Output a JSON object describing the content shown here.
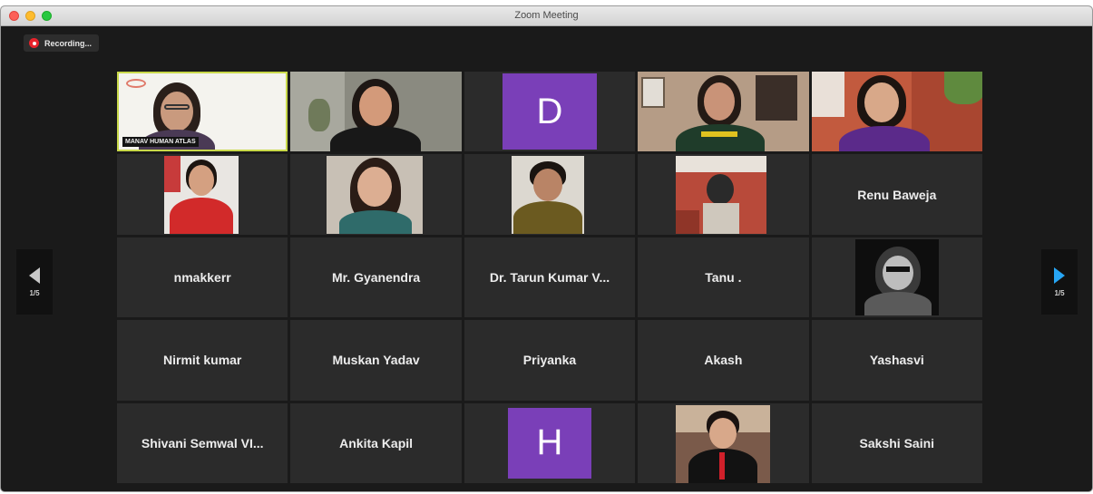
{
  "window": {
    "title": "Zoom Meeting"
  },
  "recording": {
    "label": "Recording..."
  },
  "pager": {
    "left_indicator": "1/5",
    "right_indicator": "1/5"
  },
  "participants": [
    {
      "name": "MANAV HUMAN ATLAS",
      "type": "video"
    },
    {
      "name": "",
      "type": "video"
    },
    {
      "name": "",
      "type": "initial",
      "initial": "D"
    },
    {
      "name": "",
      "type": "video"
    },
    {
      "name": "",
      "type": "video"
    },
    {
      "name": "",
      "type": "video"
    },
    {
      "name": "",
      "type": "video"
    },
    {
      "name": "",
      "type": "video"
    },
    {
      "name": "",
      "type": "video"
    },
    {
      "name": "Renu Baweja",
      "type": "name"
    },
    {
      "name": "nmakkerr",
      "type": "name"
    },
    {
      "name": "Mr. Gyanendra",
      "type": "name"
    },
    {
      "name": "Dr. Tarun Kumar V...",
      "type": "name"
    },
    {
      "name": "Tanu .",
      "type": "name"
    },
    {
      "name": "",
      "type": "video"
    },
    {
      "name": "Nirmit kumar",
      "type": "name"
    },
    {
      "name": "Muskan Yadav",
      "type": "name"
    },
    {
      "name": "Priyanka",
      "type": "name"
    },
    {
      "name": "Akash",
      "type": "name"
    },
    {
      "name": "Yashasvi",
      "type": "name"
    },
    {
      "name": "Shivani Semwal VI...",
      "type": "name"
    },
    {
      "name": "Ankita Kapil",
      "type": "name"
    },
    {
      "name": "",
      "type": "initial",
      "initial": "H"
    },
    {
      "name": "",
      "type": "video"
    },
    {
      "name": "Sakshi Saini",
      "type": "name"
    }
  ],
  "colors": {
    "tile_bg": "#2b2b2b",
    "avatar_purple": "#7a3fb8",
    "active_speaker_border": "#c9d94a",
    "recording_red": "#e8222b",
    "pager_arrow_blue": "#27a6f5"
  }
}
